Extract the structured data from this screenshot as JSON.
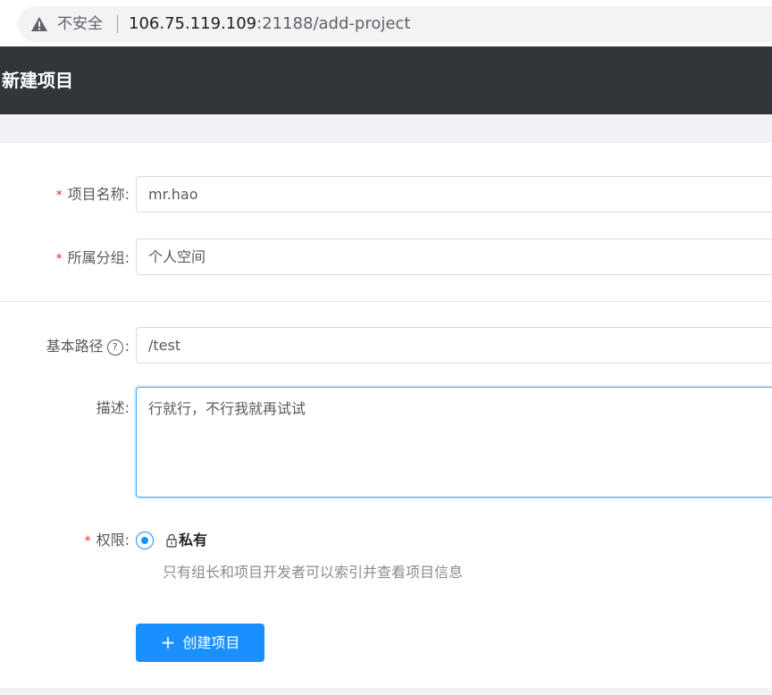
{
  "browser": {
    "security_label": "不安全",
    "url_host": "106.75.119.109",
    "url_rest": ":21188/add-project"
  },
  "header": {
    "title": "新建项目"
  },
  "form": {
    "required_mark": "*",
    "project_name": {
      "label": "项目名称:",
      "value": "mr.hao"
    },
    "group": {
      "label": "所属分组:",
      "value": "个人空间"
    },
    "base_path": {
      "label": "基本路径",
      "help": "?",
      "colon": ":",
      "value": "/test"
    },
    "description": {
      "label": "描述:",
      "value": "行就行，不行我就再试试"
    },
    "permission": {
      "label": "权限:",
      "option_label": "私有",
      "option_desc": "只有组长和项目开发者可以索引并查看项目信息"
    },
    "submit": {
      "icon": "+",
      "label": "创建项目"
    }
  },
  "colors": {
    "primary": "#1890ff",
    "header_bg": "#32363a",
    "required": "#f5222d"
  }
}
